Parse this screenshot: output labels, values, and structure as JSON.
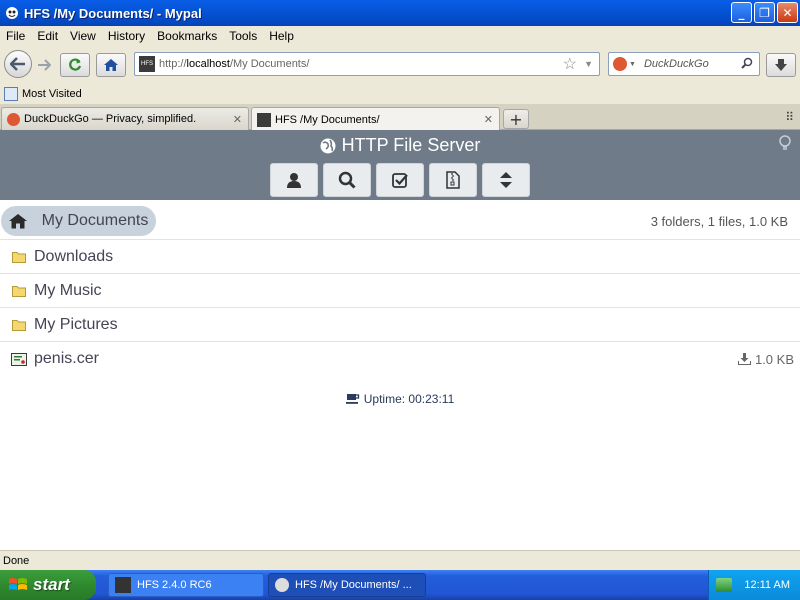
{
  "window": {
    "title": "HFS /My Documents/ - Mypal",
    "minimize": "_",
    "maximize": "❐",
    "close": "✕"
  },
  "menu": [
    "File",
    "Edit",
    "View",
    "History",
    "Bookmarks",
    "Tools",
    "Help"
  ],
  "navbar": {
    "url_scheme": "http://",
    "url_host": "localhost",
    "url_path": "/My Documents/",
    "search_placeholder": "DuckDuckGo"
  },
  "bookmarks": {
    "most_visited": "Most Visited"
  },
  "tabs": [
    {
      "label": "DuckDuckGo — Privacy, simplified.",
      "active": false
    },
    {
      "label": "HFS /My Documents/",
      "active": true
    }
  ],
  "hfs": {
    "title": "HTTP File Server",
    "folder": "My Documents",
    "summary": "3 folders, 1 files, 1.0 KB",
    "items": [
      {
        "name": "Downloads",
        "type": "folder",
        "size": ""
      },
      {
        "name": "My Music",
        "type": "folder",
        "size": ""
      },
      {
        "name": "My Pictures",
        "type": "folder",
        "size": ""
      },
      {
        "name": "penis.cer",
        "type": "file",
        "size": "1.0 KB"
      }
    ],
    "uptime": "Uptime: 00:23:11"
  },
  "status": {
    "text": "Done"
  },
  "taskbar": {
    "start_label": "start",
    "items": [
      {
        "label": "HFS 2.4.0 RC6",
        "active": false
      },
      {
        "label": "HFS /My Documents/ ...",
        "active": true
      }
    ],
    "clock": "12:11 AM"
  },
  "colors": {
    "hfs_header": "#6f7b88",
    "breadcrumb_pill": "#c8d2dc",
    "folder_icon": "#f5d76e",
    "xp_title": "#0554d6",
    "xp_start": "#2f8a2f"
  }
}
